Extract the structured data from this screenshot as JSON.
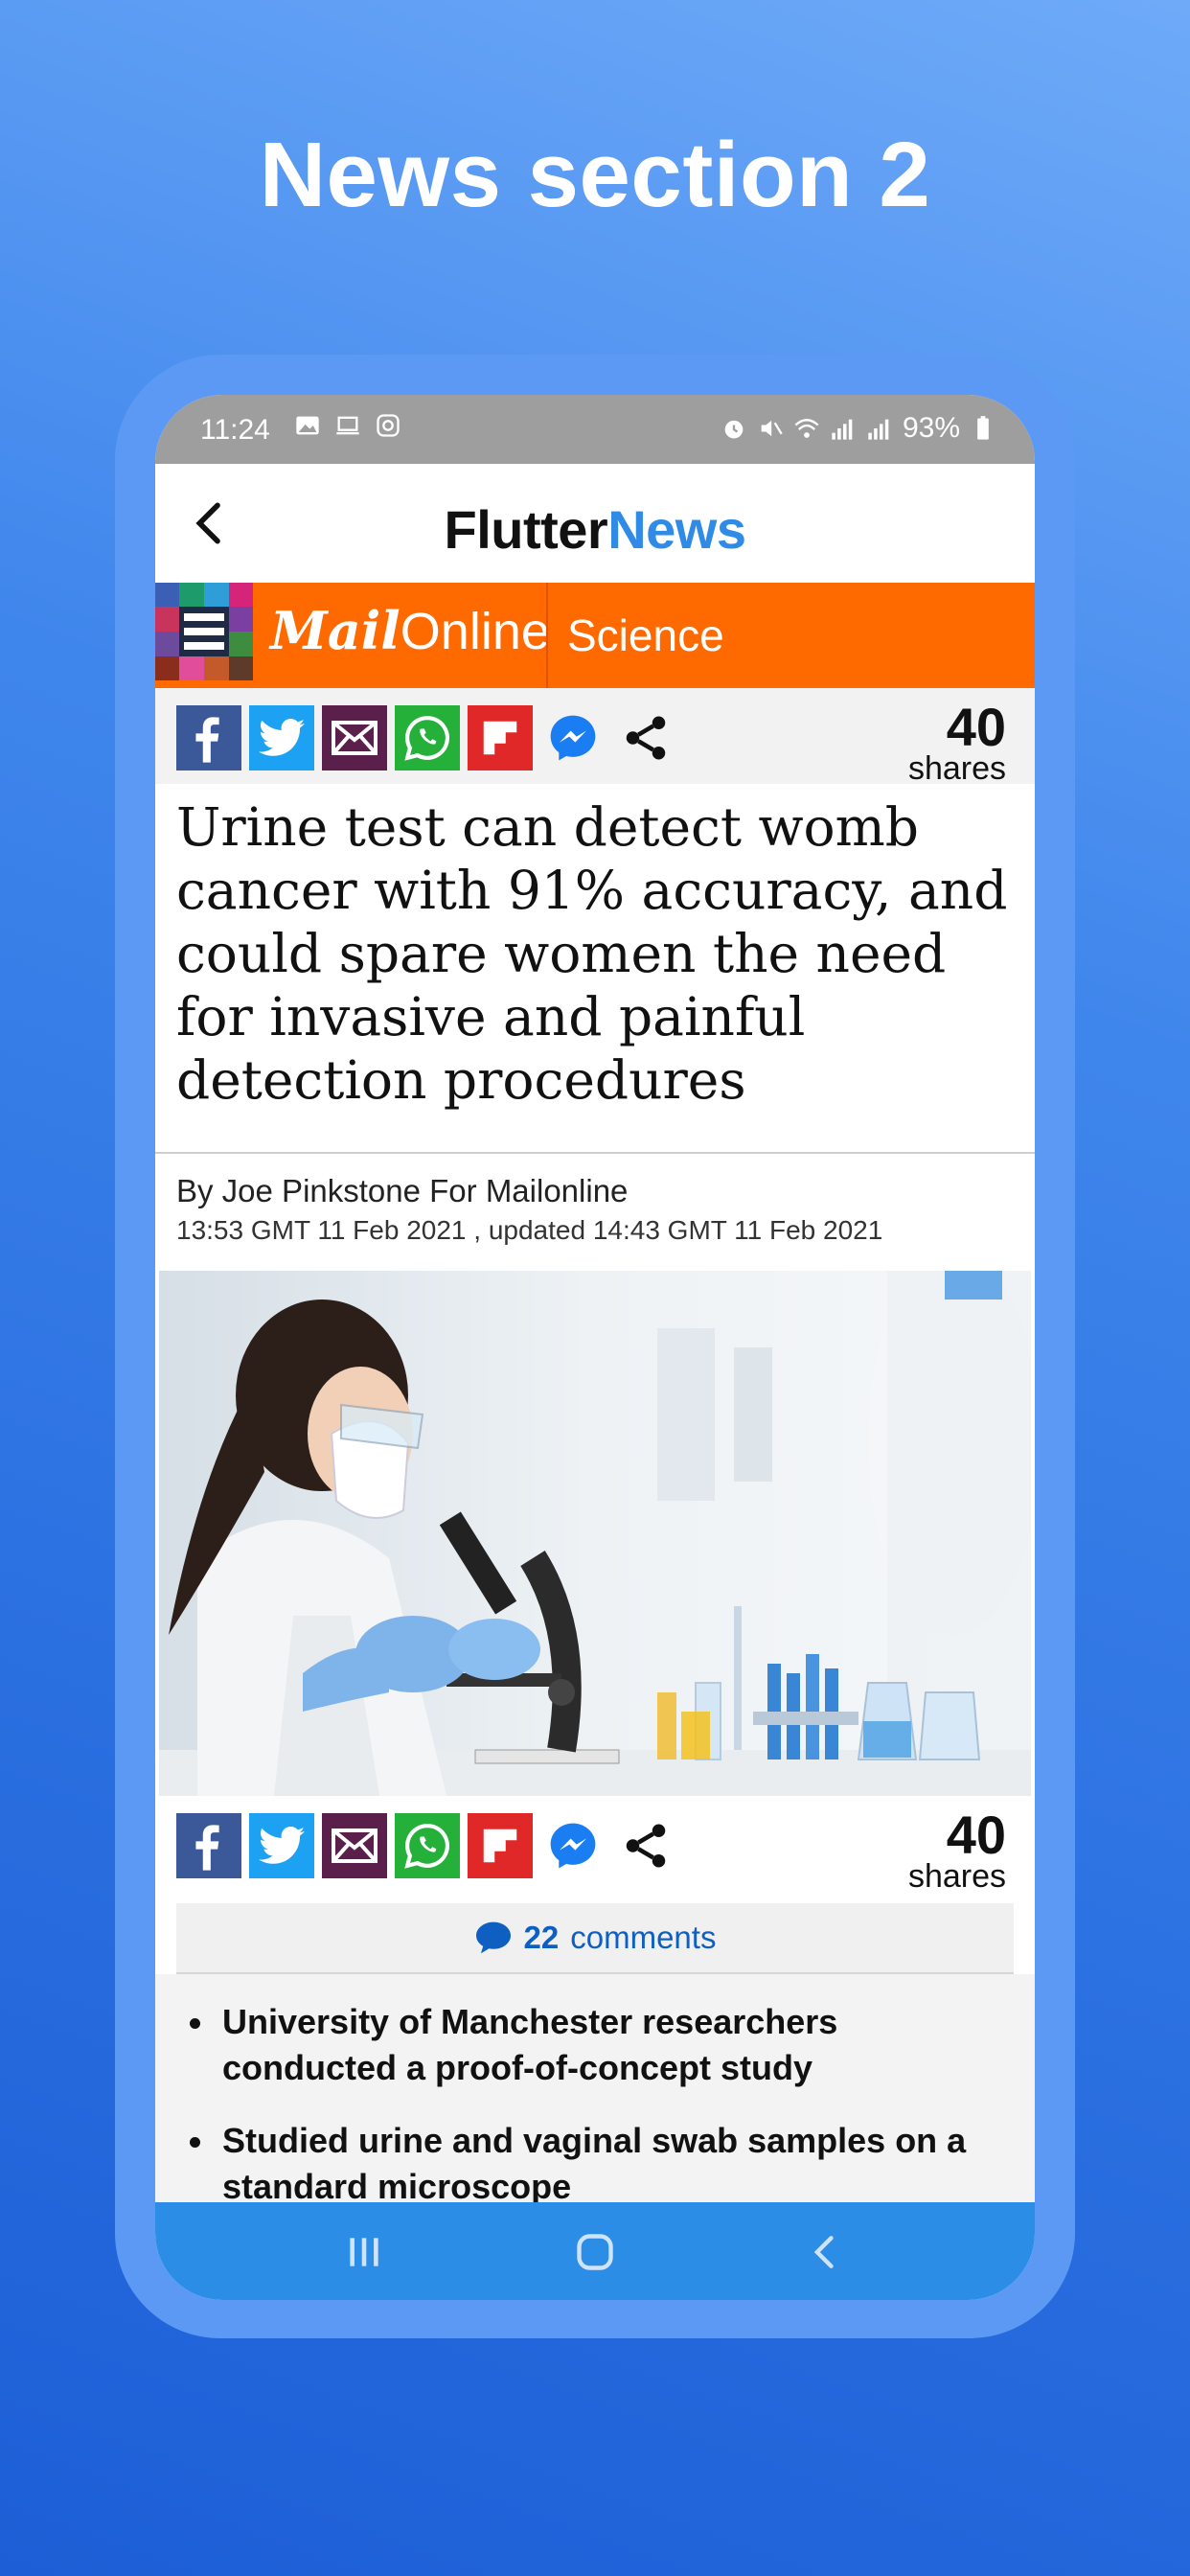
{
  "hero": {
    "title": "News section 2"
  },
  "status_bar": {
    "time": "11:24",
    "battery": "93%"
  },
  "app_bar": {
    "title_part1": "Flutter",
    "title_part2": "News"
  },
  "mail_header": {
    "logo_mail": "Mail",
    "logo_online": "Online",
    "section": "Science"
  },
  "share_top": {
    "count": "40",
    "label": "shares"
  },
  "share_bottom": {
    "count": "40",
    "label": "shares"
  },
  "share_icons": [
    "facebook-icon",
    "twitter-icon",
    "email-icon",
    "whatsapp-icon",
    "flipboard-icon",
    "messenger-icon",
    "share-icon"
  ],
  "article": {
    "headline": "Urine test can detect womb cancer with 91% accuracy, and could spare women the need for invasive and painful detection procedures",
    "byline": "By Joe Pinkstone For Mailonline",
    "dateline": "13:53 GMT 11 Feb 2021 , updated 14:43 GMT 11 Feb 2021",
    "image_alt": "Scientist using a microscope in a laboratory"
  },
  "comments": {
    "count": "22",
    "label": "comments"
  },
  "bullets": [
    "University of Manchester researchers conducted a proof-of-concept study",
    "Studied urine and vaginal swab samples on a standard microscope"
  ],
  "colors": {
    "mail_orange": "#ff6a00",
    "news_blue": "#2f8be6",
    "nav_blue": "#2b8de6"
  }
}
